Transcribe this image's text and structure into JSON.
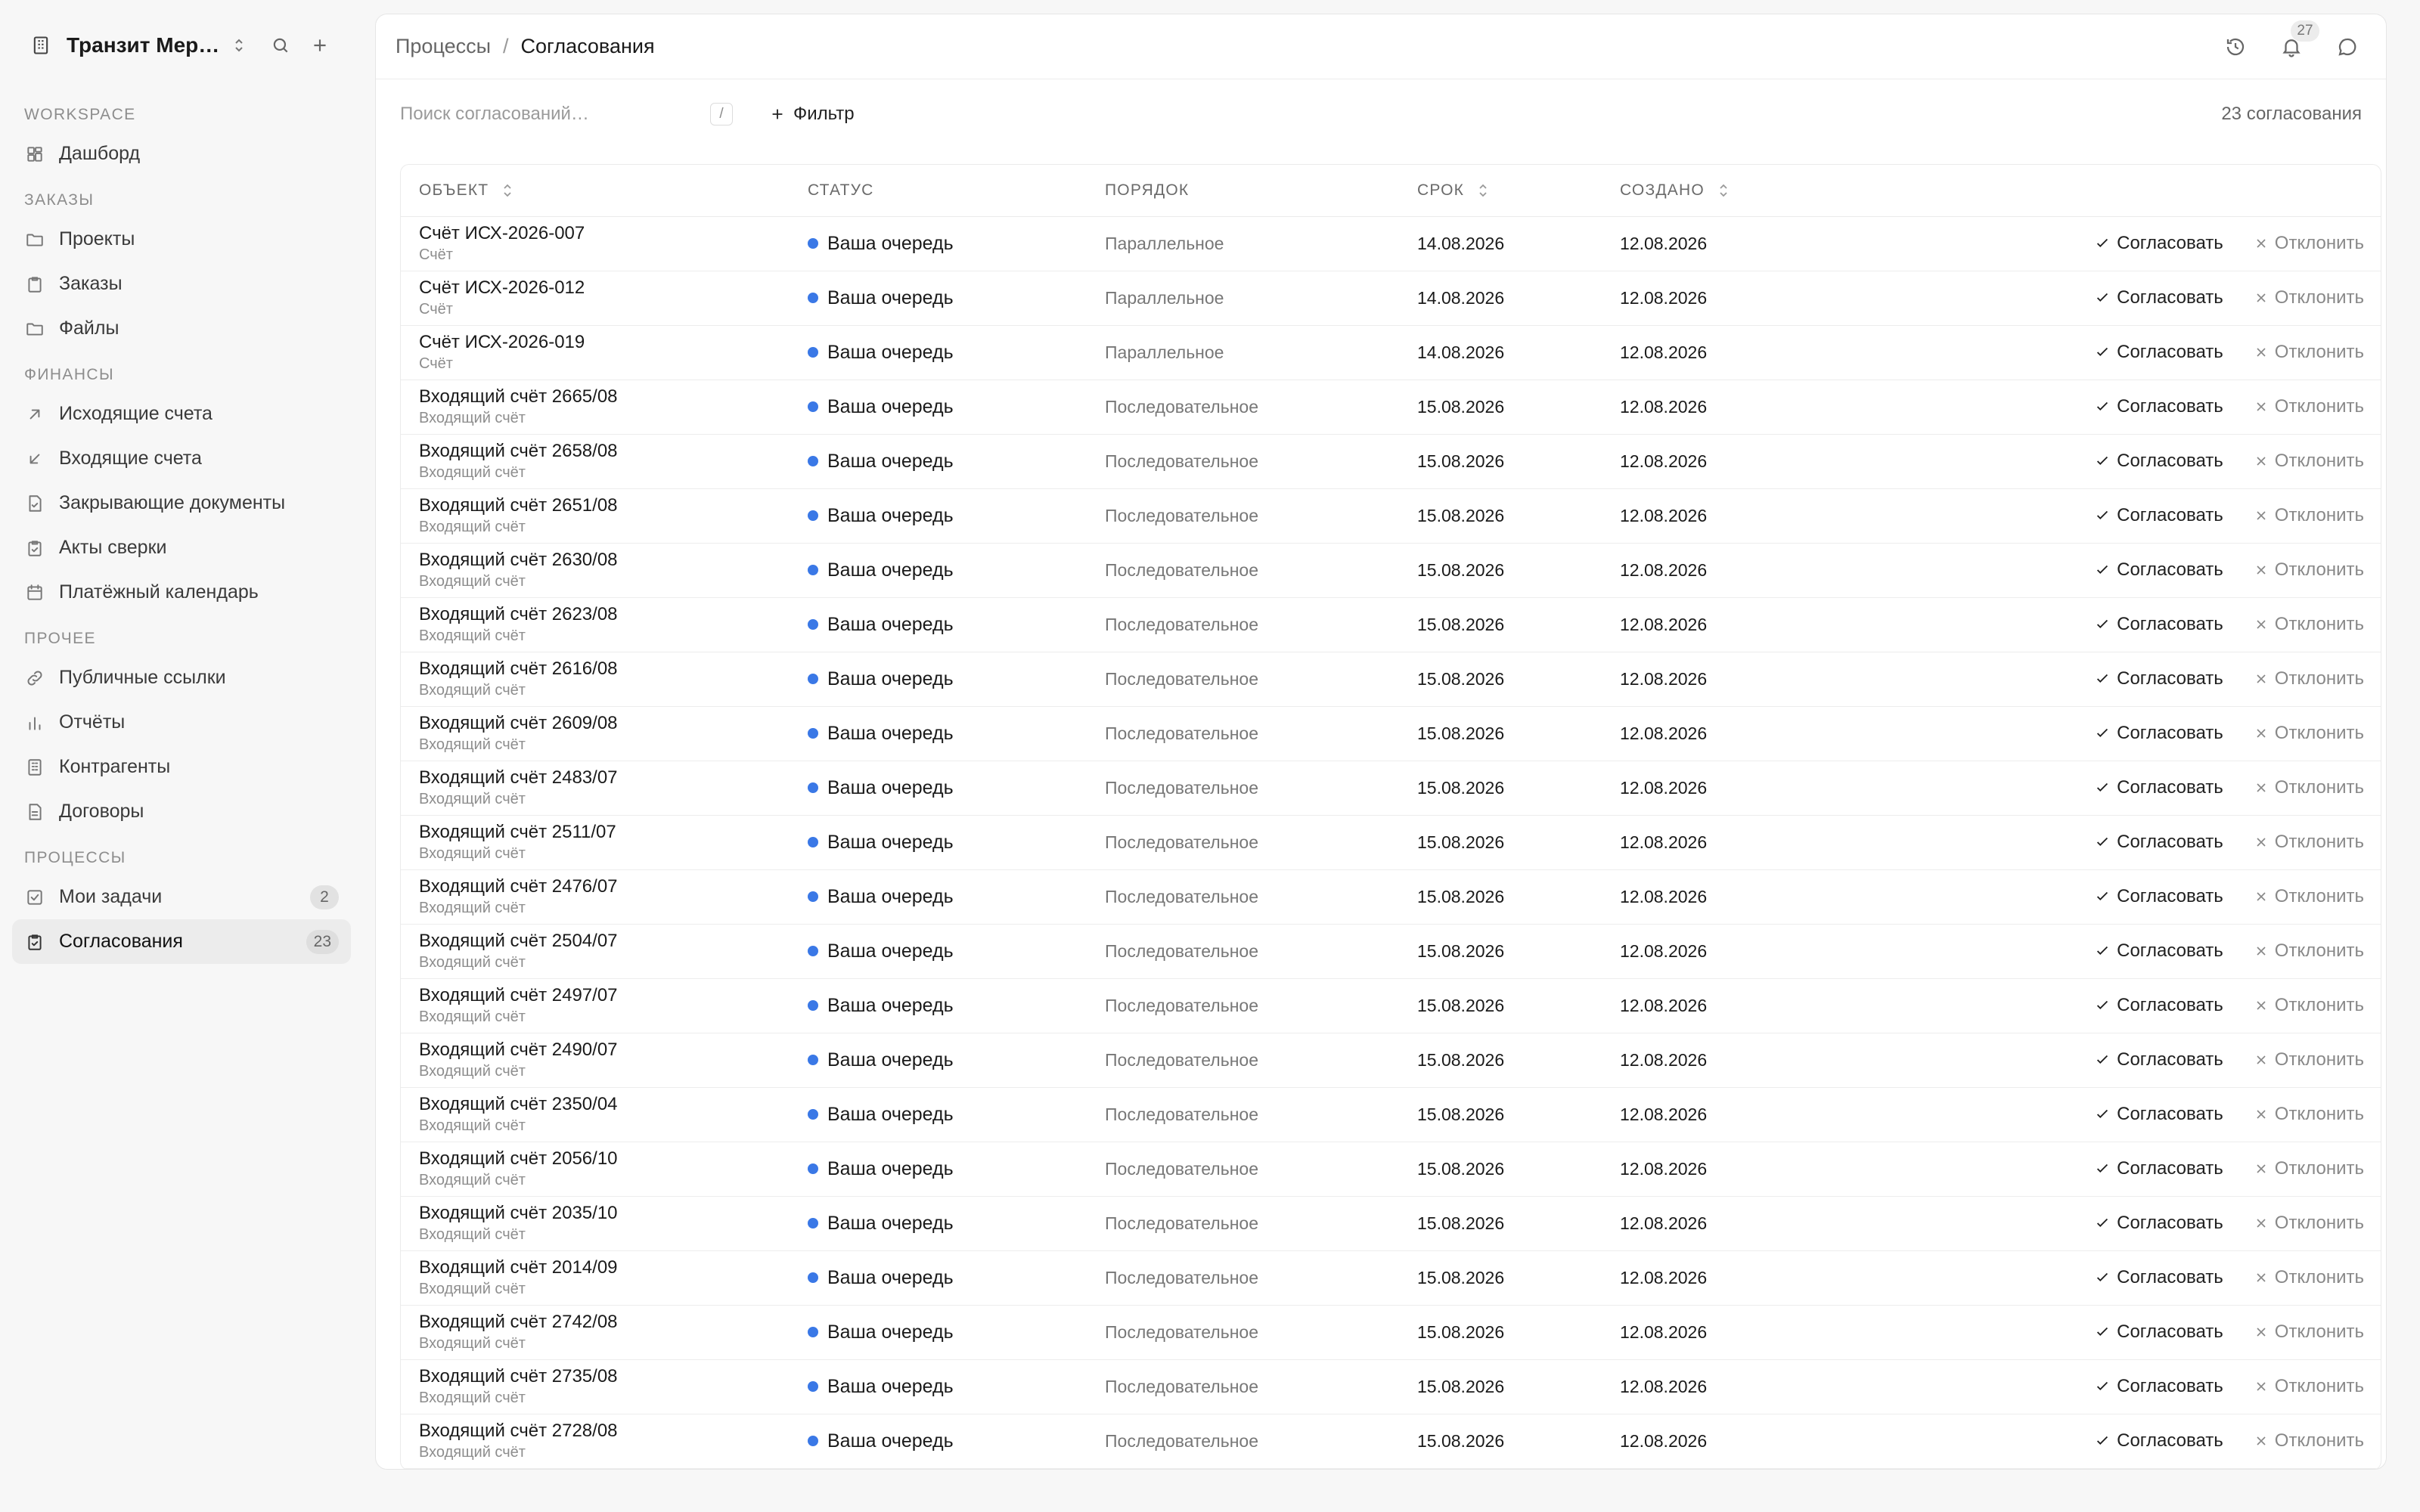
{
  "workspace": {
    "name": "Транзит Мер…"
  },
  "sidebar": {
    "sections": [
      {
        "title": "WORKSPACE",
        "items": [
          {
            "label": "Дашборд",
            "icon": "dashboard-icon"
          }
        ]
      },
      {
        "title": "ЗАКАЗЫ",
        "items": [
          {
            "label": "Проекты",
            "icon": "folder-icon"
          },
          {
            "label": "Заказы",
            "icon": "clipboard-icon"
          },
          {
            "label": "Файлы",
            "icon": "folder-icon"
          }
        ]
      },
      {
        "title": "ФИНАНСЫ",
        "items": [
          {
            "label": "Исходящие счета",
            "icon": "arrow-up-right-icon"
          },
          {
            "label": "Входящие счета",
            "icon": "arrow-down-left-icon"
          },
          {
            "label": "Закрывающие документы",
            "icon": "document-check-icon"
          },
          {
            "label": "Акты сверки",
            "icon": "clipboard-check-icon"
          },
          {
            "label": "Платёжный календарь",
            "icon": "calendar-icon"
          }
        ]
      },
      {
        "title": "ПРОЧЕЕ",
        "items": [
          {
            "label": "Публичные ссылки",
            "icon": "link-icon"
          },
          {
            "label": "Отчёты",
            "icon": "bar-chart-icon"
          },
          {
            "label": "Контрагенты",
            "icon": "building-icon"
          },
          {
            "label": "Договоры",
            "icon": "document-icon"
          }
        ]
      },
      {
        "title": "ПРОЦЕССЫ",
        "items": [
          {
            "label": "Мои задачи",
            "icon": "checkbox-icon",
            "count": "2"
          },
          {
            "label": "Согласования",
            "icon": "clipboard-check-icon",
            "count": "23",
            "active": true
          }
        ]
      }
    ]
  },
  "breadcrumb": {
    "parent": "Процессы",
    "separator": "/",
    "current": "Согласования"
  },
  "notifications": {
    "count": "27"
  },
  "toolbar": {
    "search_placeholder": "Поиск согласований…",
    "search_shortcut": "/",
    "filter_label": "Фильтр",
    "total_label": "23 согласования"
  },
  "table": {
    "columns": {
      "object": "ОБЪЕКТ",
      "status": "СТАТУС",
      "order": "ПОРЯДОК",
      "due": "СРОК",
      "created": "СОЗДАНО"
    },
    "approve_label": "Согласовать",
    "reject_label": "Отклонить",
    "rows": [
      {
        "title": "Счёт ИСХ-2026-007",
        "type": "Счёт",
        "status": "Ваша очередь",
        "order": "Параллельное",
        "due": "14.08.2026",
        "created": "12.08.2026"
      },
      {
        "title": "Счёт ИСХ-2026-012",
        "type": "Счёт",
        "status": "Ваша очередь",
        "order": "Параллельное",
        "due": "14.08.2026",
        "created": "12.08.2026"
      },
      {
        "title": "Счёт ИСХ-2026-019",
        "type": "Счёт",
        "status": "Ваша очередь",
        "order": "Параллельное",
        "due": "14.08.2026",
        "created": "12.08.2026"
      },
      {
        "title": "Входящий счёт 2665/08",
        "type": "Входящий счёт",
        "status": "Ваша очередь",
        "order": "Последовательное",
        "due": "15.08.2026",
        "created": "12.08.2026"
      },
      {
        "title": "Входящий счёт 2658/08",
        "type": "Входящий счёт",
        "status": "Ваша очередь",
        "order": "Последовательное",
        "due": "15.08.2026",
        "created": "12.08.2026"
      },
      {
        "title": "Входящий счёт 2651/08",
        "type": "Входящий счёт",
        "status": "Ваша очередь",
        "order": "Последовательное",
        "due": "15.08.2026",
        "created": "12.08.2026"
      },
      {
        "title": "Входящий счёт 2630/08",
        "type": "Входящий счёт",
        "status": "Ваша очередь",
        "order": "Последовательное",
        "due": "15.08.2026",
        "created": "12.08.2026"
      },
      {
        "title": "Входящий счёт 2623/08",
        "type": "Входящий счёт",
        "status": "Ваша очередь",
        "order": "Последовательное",
        "due": "15.08.2026",
        "created": "12.08.2026"
      },
      {
        "title": "Входящий счёт 2616/08",
        "type": "Входящий счёт",
        "status": "Ваша очередь",
        "order": "Последовательное",
        "due": "15.08.2026",
        "created": "12.08.2026"
      },
      {
        "title": "Входящий счёт 2609/08",
        "type": "Входящий счёт",
        "status": "Ваша очередь",
        "order": "Последовательное",
        "due": "15.08.2026",
        "created": "12.08.2026"
      },
      {
        "title": "Входящий счёт 2483/07",
        "type": "Входящий счёт",
        "status": "Ваша очередь",
        "order": "Последовательное",
        "due": "15.08.2026",
        "created": "12.08.2026"
      },
      {
        "title": "Входящий счёт 2511/07",
        "type": "Входящий счёт",
        "status": "Ваша очередь",
        "order": "Последовательное",
        "due": "15.08.2026",
        "created": "12.08.2026"
      },
      {
        "title": "Входящий счёт 2476/07",
        "type": "Входящий счёт",
        "status": "Ваша очередь",
        "order": "Последовательное",
        "due": "15.08.2026",
        "created": "12.08.2026"
      },
      {
        "title": "Входящий счёт 2504/07",
        "type": "Входящий счёт",
        "status": "Ваша очередь",
        "order": "Последовательное",
        "due": "15.08.2026",
        "created": "12.08.2026"
      },
      {
        "title": "Входящий счёт 2497/07",
        "type": "Входящий счёт",
        "status": "Ваша очередь",
        "order": "Последовательное",
        "due": "15.08.2026",
        "created": "12.08.2026"
      },
      {
        "title": "Входящий счёт 2490/07",
        "type": "Входящий счёт",
        "status": "Ваша очередь",
        "order": "Последовательное",
        "due": "15.08.2026",
        "created": "12.08.2026"
      },
      {
        "title": "Входящий счёт 2350/04",
        "type": "Входящий счёт",
        "status": "Ваша очередь",
        "order": "Последовательное",
        "due": "15.08.2026",
        "created": "12.08.2026"
      },
      {
        "title": "Входящий счёт 2056/10",
        "type": "Входящий счёт",
        "status": "Ваша очередь",
        "order": "Последовательное",
        "due": "15.08.2026",
        "created": "12.08.2026"
      },
      {
        "title": "Входящий счёт 2035/10",
        "type": "Входящий счёт",
        "status": "Ваша очередь",
        "order": "Последовательное",
        "due": "15.08.2026",
        "created": "12.08.2026"
      },
      {
        "title": "Входящий счёт 2014/09",
        "type": "Входящий счёт",
        "status": "Ваша очередь",
        "order": "Последовательное",
        "due": "15.08.2026",
        "created": "12.08.2026"
      },
      {
        "title": "Входящий счёт 2742/08",
        "type": "Входящий счёт",
        "status": "Ваша очередь",
        "order": "Последовательное",
        "due": "15.08.2026",
        "created": "12.08.2026"
      },
      {
        "title": "Входящий счёт 2735/08",
        "type": "Входящий счёт",
        "status": "Ваша очередь",
        "order": "Последовательное",
        "due": "15.08.2026",
        "created": "12.08.2026"
      },
      {
        "title": "Входящий счёт 2728/08",
        "type": "Входящий счёт",
        "status": "Ваша очередь",
        "order": "Последовательное",
        "due": "15.08.2026",
        "created": "12.08.2026"
      }
    ]
  },
  "colors": {
    "status_dot": "#3a78e6",
    "active_nav_bg": "#ececec"
  }
}
